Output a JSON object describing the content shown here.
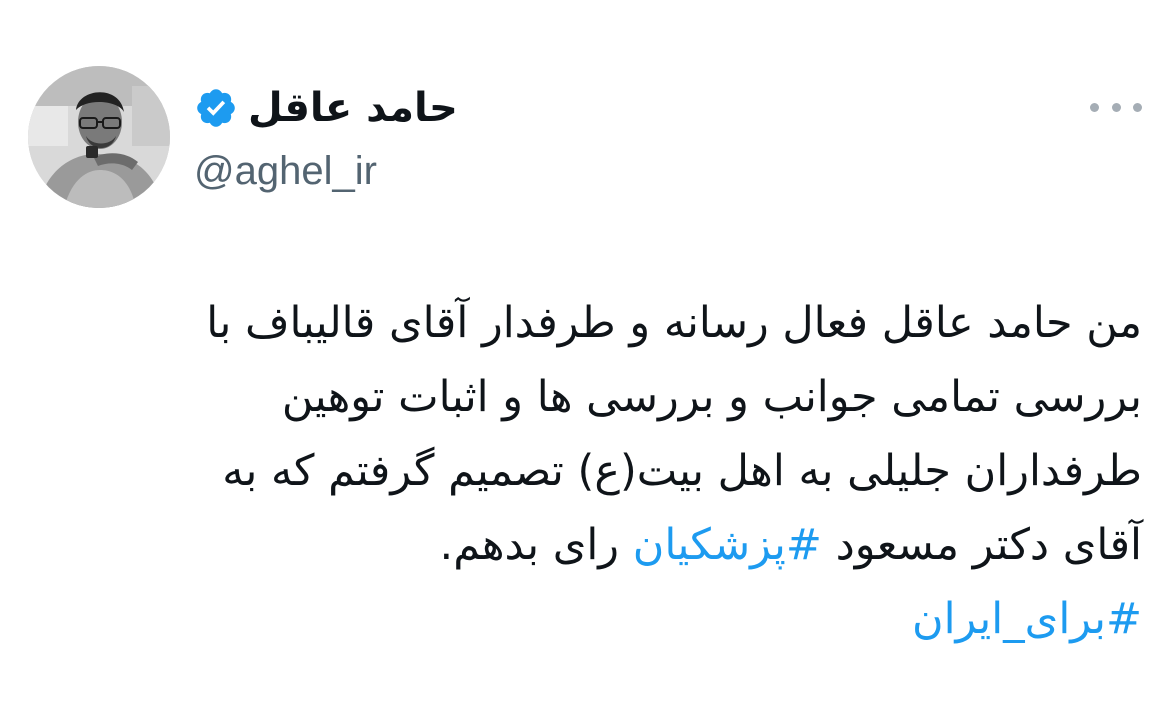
{
  "author": {
    "display_name": "حامد عاقل",
    "handle": "@aghel_ir",
    "verified": true,
    "verified_color": "#1d9bf0"
  },
  "menu": {
    "more_icon": "more-horizontal-icon"
  },
  "tweet": {
    "line1": "من حامد عاقل فعال رسانه و طرفدار آقای قالیباف با",
    "line2": "بررسی تمامی جوانب و بررسی ها و اثبات توهین",
    "line3": "طرفداران جلیلی به اهل بیت(ع) تصمیم گرفتم که به",
    "line4_before": "آقای دکتر مسعود ",
    "hashtag1": "#پزشکیان",
    "line4_after": " رای بدهم.",
    "hashtag2": "#برای_ایران"
  },
  "colors": {
    "text": "#0f1419",
    "secondary_text": "#536471",
    "link": "#1d9bf0",
    "background": "#ffffff"
  }
}
